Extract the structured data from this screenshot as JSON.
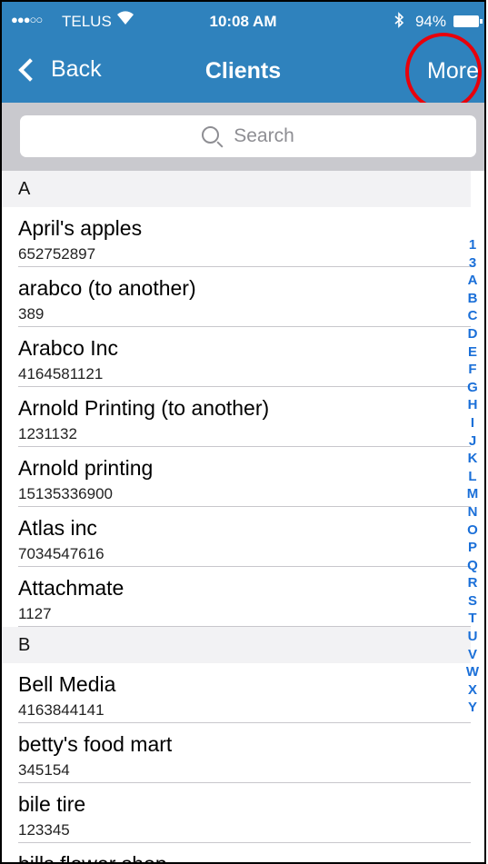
{
  "status": {
    "signal": "●●●○○",
    "carrier": "TELUS",
    "time": "10:08 AM",
    "battery": "94%"
  },
  "nav": {
    "back_label": "Back",
    "title": "Clients",
    "more_label": "More"
  },
  "search": {
    "placeholder": "Search"
  },
  "sections": [
    {
      "letter": "A",
      "items": [
        {
          "name": "April's apples",
          "number": "652752897"
        },
        {
          "name": "arabco (to another)",
          "number": "389"
        },
        {
          "name": "Arabco Inc",
          "number": "4164581121"
        },
        {
          "name": "Arnold Printing (to another)",
          "number": "1231132"
        },
        {
          "name": "Arnold printing",
          "number": "15135336900"
        },
        {
          "name": "Atlas inc",
          "number": "7034547616"
        },
        {
          "name": "Attachmate",
          "number": "1127"
        }
      ]
    },
    {
      "letter": "B",
      "items": [
        {
          "name": "Bell Media",
          "number": "4163844141"
        },
        {
          "name": "betty's food mart",
          "number": "345154"
        },
        {
          "name": "bile tire",
          "number": "123345"
        },
        {
          "name": "bills flower shop",
          "number": ""
        }
      ]
    }
  ],
  "index_letters": [
    "1",
    "3",
    "A",
    "B",
    "C",
    "D",
    "E",
    "F",
    "G",
    "H",
    "I",
    "J",
    "K",
    "L",
    "M",
    "N",
    "O",
    "P",
    "Q",
    "R",
    "S",
    "T",
    "U",
    "V",
    "W",
    "X",
    "Y"
  ],
  "colors": {
    "nav_bar": "#2f82bd",
    "index_text": "#1a6fd8",
    "annotation_circle": "#e8000b",
    "search_bar_bg": "#c9c9ce",
    "section_header_bg": "#f2f2f4"
  },
  "icons": {
    "back": "chevron-left-icon",
    "search": "search-icon",
    "wifi": "wifi-icon",
    "bluetooth": "bluetooth-icon",
    "battery": "battery-icon"
  }
}
